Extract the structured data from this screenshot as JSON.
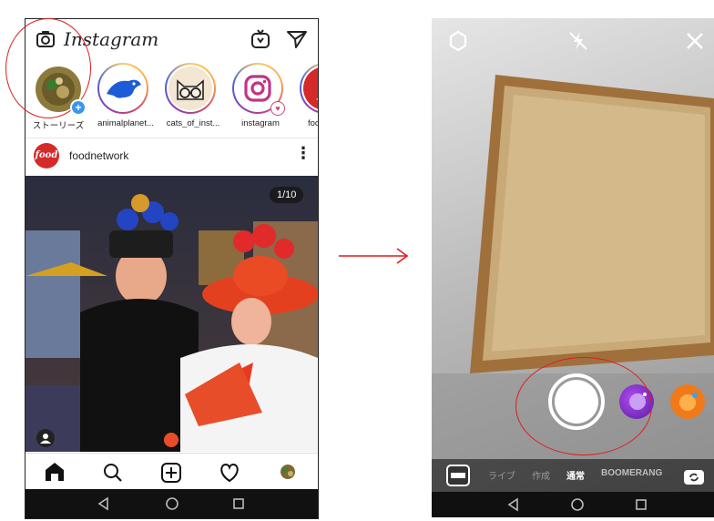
{
  "left_screen": {
    "app_title": "Instagram",
    "header_icons": [
      "camera-icon",
      "igtv-icon",
      "direct-message-icon"
    ],
    "stories": [
      {
        "label": "ストーリーズ",
        "type": "own"
      },
      {
        "label": "animalplanet...",
        "type": "brand"
      },
      {
        "label": "cats_of_inst...",
        "type": "brand"
      },
      {
        "label": "instagram",
        "type": "brand"
      },
      {
        "label": "food",
        "type": "brand"
      }
    ],
    "post": {
      "username": "foodnetwork",
      "avatar_text": "food",
      "more_symbol": "⋮",
      "counter": "1/10"
    },
    "tabs": [
      "home-icon",
      "search-icon",
      "add-icon",
      "heart-icon",
      "profile-icon"
    ],
    "nav": [
      "back-icon",
      "home-circle-icon",
      "recents-icon"
    ]
  },
  "right_screen": {
    "top_icons": [
      "settings-icon",
      "flash-off-icon",
      "close-icon"
    ],
    "modes": [
      {
        "label": "ライブ",
        "selected": false
      },
      {
        "label": "作成",
        "selected": false
      },
      {
        "label": "通常",
        "selected": true
      },
      {
        "label": "BOOMERANG",
        "selected": false
      }
    ],
    "nav": [
      "back-icon",
      "home-circle-icon",
      "recents-icon"
    ]
  },
  "colors": {
    "annotation": "#e11c1c",
    "instagram_pink": "#cd486b",
    "feed_bg": "#ffffff",
    "navbar": "#111111"
  }
}
